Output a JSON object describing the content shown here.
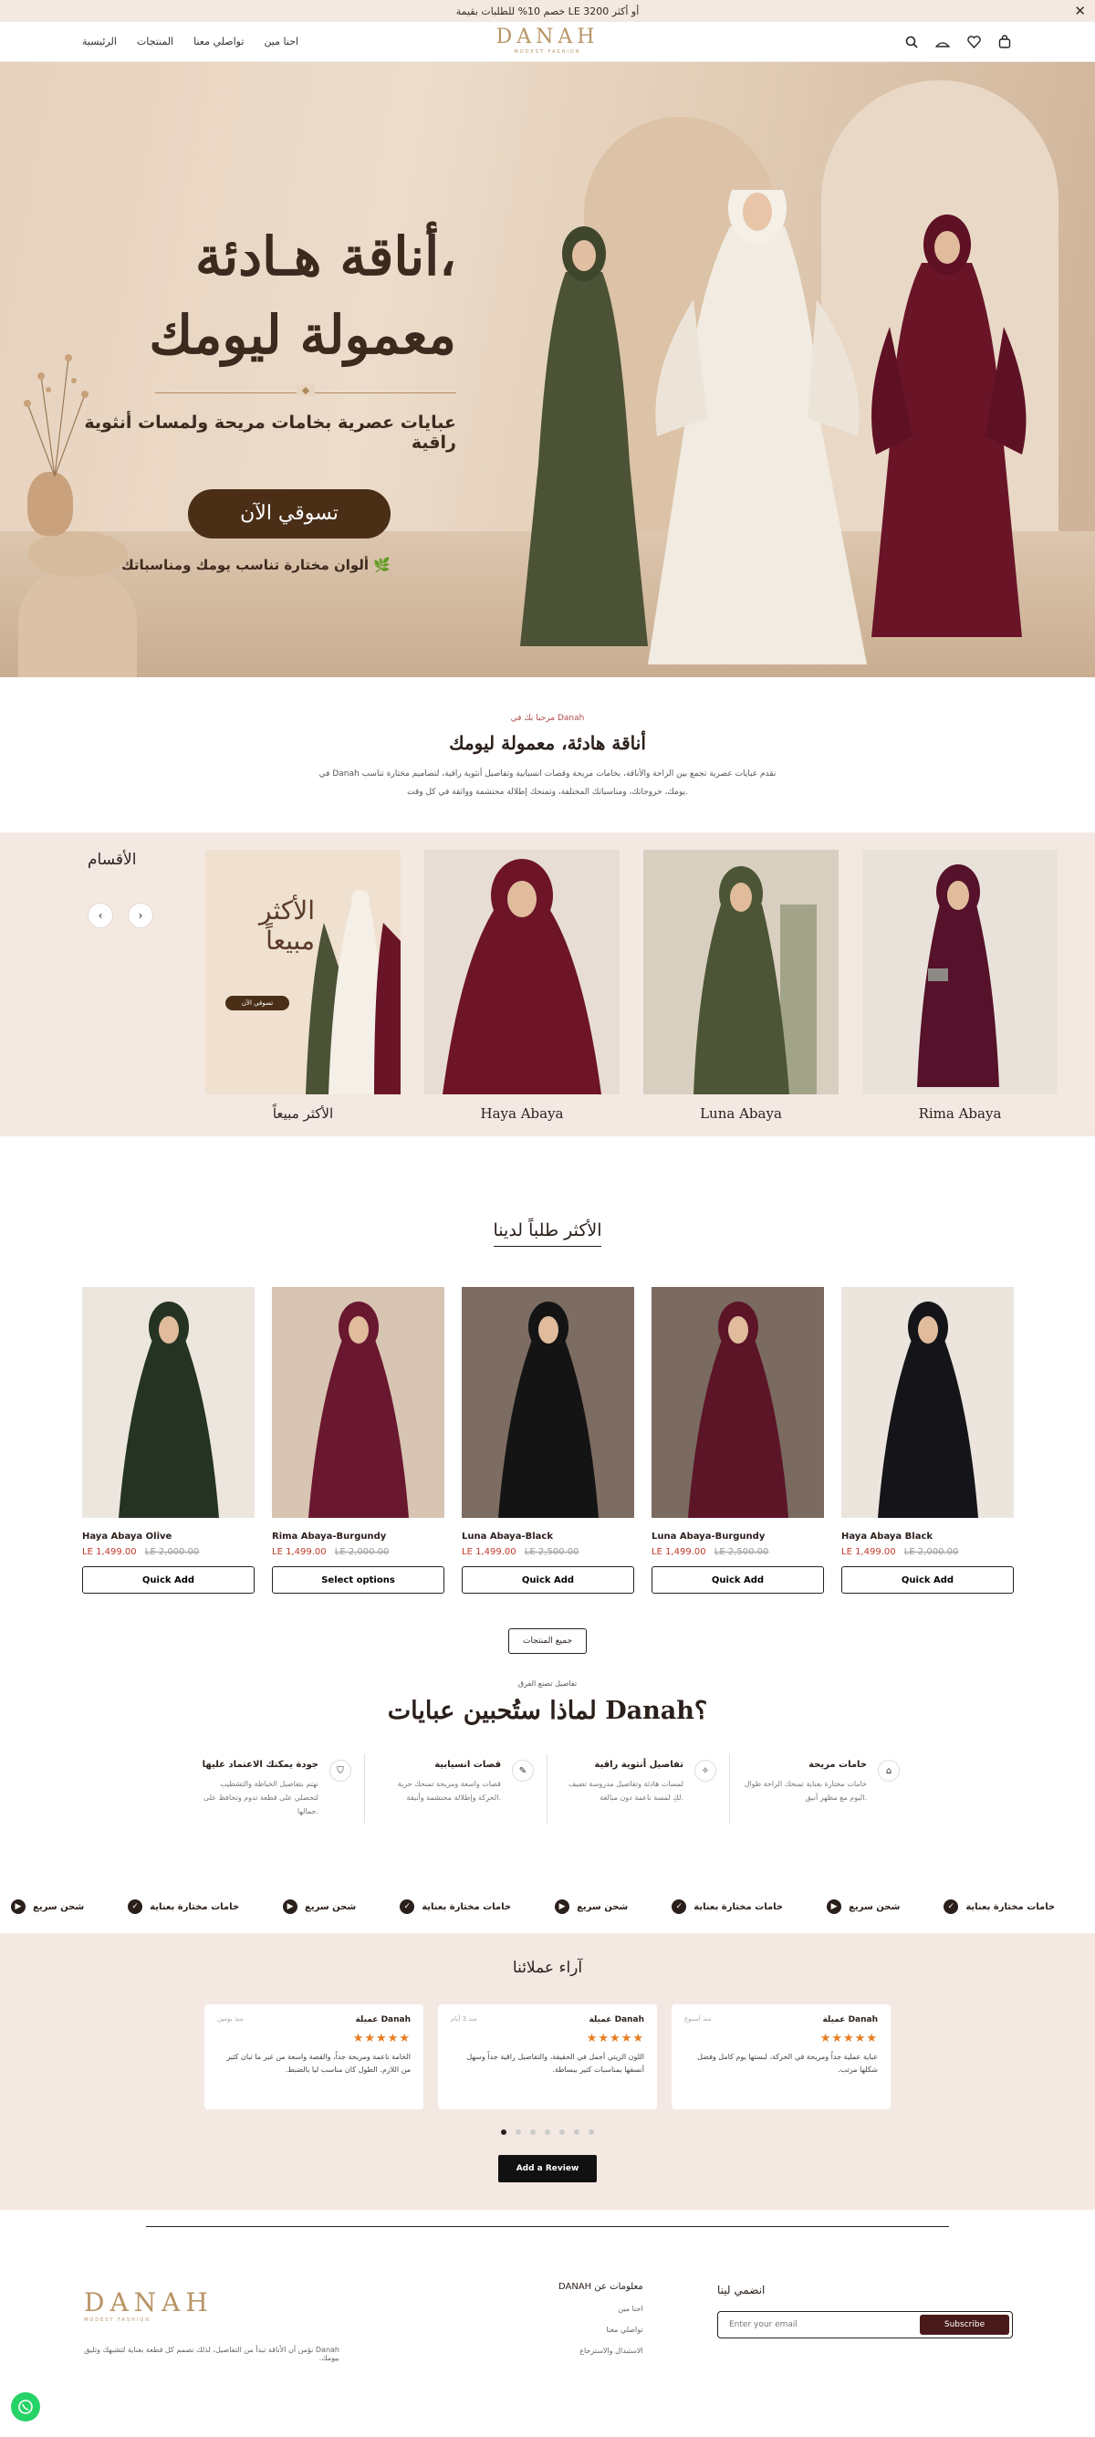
{
  "announcement": {
    "text": "خصم 10% للطلبات بقيمة LE 3200 أو أكثر",
    "close": "✕"
  },
  "header": {
    "nav": [
      "الرئيسية",
      "المنتجات",
      "تواصلي معنا",
      "احنا مين"
    ],
    "logo": "DANAH",
    "logo_tag": "MODEST FASHION",
    "icons": [
      "search-icon",
      "account-icon",
      "wishlist-icon",
      "cart-icon"
    ]
  },
  "hero": {
    "title_line1": "أناقة هـادئة،",
    "title_line2": "معمولة ليومك",
    "subtitle": "عبايات عصرية بخامات مريحة ولمسات أنثوية راقية",
    "cta": "تسوقي الآن",
    "note": "ألوان مختارة تناسب يومك ومناسباتك"
  },
  "intro": {
    "eyebrow": "مرحبا بك في Danah",
    "title": "أناقة هادئة، معمولة ليومك",
    "line1": "في Danah نقدم عبايات عصرية تجمع بين الراحة والأناقة، بخامات مريحة وقصات انسيابية وتفاصيل أنثوية راقية، لتصاميم مختارة تناسب",
    "line2": "يومك، خروجاتك، ومناسباتك المختلفة، وتمنحك إطلالة محتشمة وواثقة في كل وقت."
  },
  "categories": {
    "title": "الأقسام",
    "promo": {
      "line1": "الأكثر",
      "line2": "مبيعاً",
      "button": "تسوقي الآن"
    },
    "items": [
      {
        "label": "الأكثر مبيعاً",
        "color": "#efe0d0"
      },
      {
        "label": "Haya Abaya",
        "color": "#6e1428"
      },
      {
        "label": "Luna Abaya",
        "color": "#4c5535"
      },
      {
        "label": "Rima Abaya",
        "color": "#55122a"
      }
    ]
  },
  "bestsellers": {
    "title": "الأكثر طلباً لدينا",
    "products": [
      {
        "name": "Haya Abaya Olive",
        "price": "LE 1,499.00",
        "old": "LE 2,000.00",
        "button": "Quick Add",
        "color": "#253322",
        "bg": "#ece6df"
      },
      {
        "name": "Rima Abaya-Burgundy",
        "price": "LE 1,499.00",
        "old": "LE 2,000.00",
        "button": "Select options",
        "color": "#6a1730",
        "bg": "#d8c4b2"
      },
      {
        "name": "Luna Abaya-Black",
        "price": "LE 1,499.00",
        "old": "LE 2,500.00",
        "button": "Quick Add",
        "color": "#141414",
        "bg": "#7d6c62"
      },
      {
        "name": "Luna Abaya-Burgundy",
        "price": "LE 1,499.00",
        "old": "LE 2,500.00",
        "button": "Quick Add",
        "color": "#5c1427",
        "bg": "#7a6a60"
      },
      {
        "name": "Haya Abaya Black",
        "price": "LE 1,499.00",
        "old": "LE 2,000.00",
        "button": "Quick Add",
        "color": "#151519",
        "bg": "#ebe5de"
      }
    ],
    "all_button": "جميع المنتجات"
  },
  "why": {
    "eyebrow": "تفاصيل تصنع الفرق",
    "title": "لماذا ستُحبين عبايات Danah؟",
    "features": [
      {
        "title": "جودة يمكنك الاعتماد عليها",
        "text": "نهتم بتفاصيل الخياطة والتشطيب لتحصلي على قطعة تدوم وتحافظ على جمالها.",
        "icon": "shield-icon"
      },
      {
        "title": "قصات انسيابية",
        "text": "قصات واسعة ومريحة تمنحك حرية الحركة وإطلالة محتشمة وأنيقة.",
        "icon": "pen-icon"
      },
      {
        "title": "تفاصيل أنثوية راقية",
        "text": "لمسات هادئة وتفاصيل مدروسة تضيف لكِ لمسة ناعمة دون مبالغة.",
        "icon": "sparkle-icon"
      },
      {
        "title": "خامات مريحة",
        "text": "خامات مختارة بعناية تمنحك الراحة طوال اليوم مع مظهر أنيق.",
        "icon": "shirt-icon"
      }
    ]
  },
  "marquee": {
    "items": [
      "شحن سريع",
      "خامات مختارة بعناية",
      "شحن سريع",
      "خامات مختارة بعناية",
      "شحن سريع",
      "خامات مختارة بعناية",
      "شحن سريع",
      "خامات مختارة بعناية",
      "شحن سريع",
      "خامات مختارة بعناية",
      "شحن سريع"
    ]
  },
  "reviews": {
    "title": "آراء عملائنا",
    "items": [
      {
        "name": "Danah عميلة",
        "date": "منذ يومين",
        "stars": "★★★★★",
        "text": "الخامة ناعمة ومريحة جداً، والقصة واسعة من غير ما تبان كثير من اللازم. الطول كان مناسب ليا بالضبط."
      },
      {
        "name": "Danah عميلة",
        "date": "منذ 3 أيام",
        "stars": "★★★★★",
        "text": "اللون الزيتي أجمل في الحقيقة، والتفاصيل راقية جداً وسهل أنسقها بمناسبات كتير ببساطة."
      },
      {
        "name": "Danah عميلة",
        "date": "منذ أسبوع",
        "stars": "★★★★★",
        "text": "عباية عملية جداً ومريحة في الحركة، لبستها يوم كامل وفضل شكلها مرتب."
      }
    ],
    "dots": 7,
    "button": "Add a Review"
  },
  "footer": {
    "logo": "DANAH",
    "logo_tag": "MODEST FASHION",
    "about": "Danah نؤمن أن الأناقة تبدأ من التفاصيل، لذلك نصمم كل قطعة بعناية لتشبهك وتليق بيومك.",
    "links_title": "معلومات عن DANAH",
    "links": [
      "احنا مين",
      "تواصلي معنا",
      "الاستبدال والاسترجاع"
    ],
    "join_title": "انضمي لينا",
    "email_placeholder": "Enter your email",
    "subscribe": "Subscribe"
  }
}
